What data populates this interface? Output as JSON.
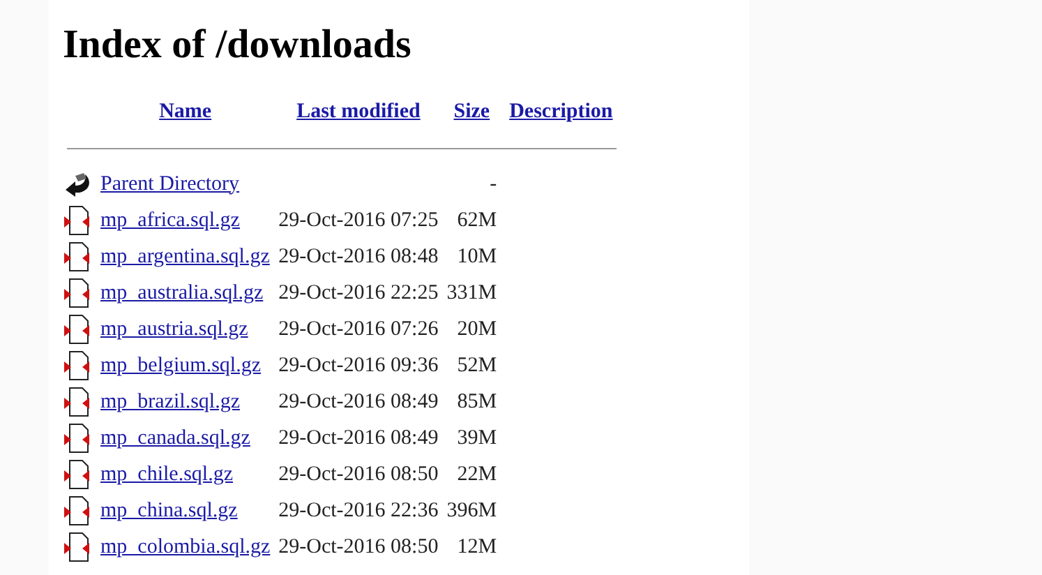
{
  "title": "Index of /downloads",
  "columns": [
    "Name",
    "Last modified",
    "Size",
    "Description"
  ],
  "rows": [
    {
      "kind": "parent",
      "name": "Parent Directory",
      "modified": "",
      "size": "-"
    },
    {
      "kind": "file",
      "name": "mp_africa.sql.gz",
      "modified": "29-Oct-2016 07:25",
      "size": "62M"
    },
    {
      "kind": "file",
      "name": "mp_argentina.sql.gz",
      "modified": "29-Oct-2016 08:48",
      "size": "10M"
    },
    {
      "kind": "file",
      "name": "mp_australia.sql.gz",
      "modified": "29-Oct-2016 22:25",
      "size": "331M"
    },
    {
      "kind": "file",
      "name": "mp_austria.sql.gz",
      "modified": "29-Oct-2016 07:26",
      "size": "20M"
    },
    {
      "kind": "file",
      "name": "mp_belgium.sql.gz",
      "modified": "29-Oct-2016 09:36",
      "size": "52M"
    },
    {
      "kind": "file",
      "name": "mp_brazil.sql.gz",
      "modified": "29-Oct-2016 08:49",
      "size": "85M"
    },
    {
      "kind": "file",
      "name": "mp_canada.sql.gz",
      "modified": "29-Oct-2016 08:49",
      "size": "39M"
    },
    {
      "kind": "file",
      "name": "mp_chile.sql.gz",
      "modified": "29-Oct-2016 08:50",
      "size": "22M"
    },
    {
      "kind": "file",
      "name": "mp_china.sql.gz",
      "modified": "29-Oct-2016 22:36",
      "size": "396M"
    },
    {
      "kind": "file",
      "name": "mp_colombia.sql.gz",
      "modified": "29-Oct-2016 08:50",
      "size": "12M"
    }
  ]
}
